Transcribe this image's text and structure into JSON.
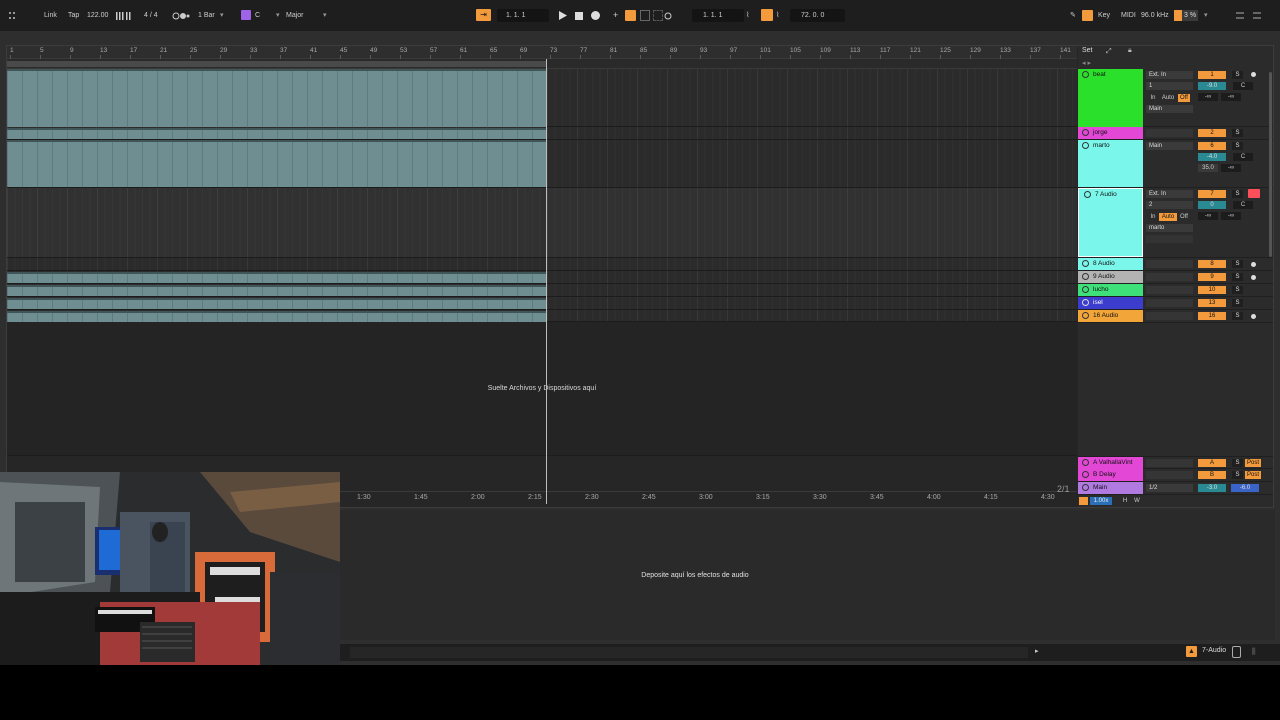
{
  "topbar": {
    "link": "Link",
    "tap": "Tap",
    "tempo": "122.00",
    "time_sig": "4 / 4",
    "quantize": "1 Bar",
    "key_root": "C",
    "scale": "Major",
    "arrangement_position": "1.   1.   1",
    "loop_start": "1.   1.   1",
    "loop_length": "72.   0.   0",
    "key_label": "Key",
    "midi_label": "MIDI",
    "sample_rate": "96.0 kHz",
    "cpu": "3 %"
  },
  "ruler": {
    "bars": [
      "1",
      "5",
      "9",
      "13",
      "17",
      "21",
      "25",
      "29",
      "33",
      "37",
      "41",
      "45",
      "49",
      "53",
      "57",
      "61",
      "65",
      "69",
      "73",
      "77",
      "81",
      "85",
      "89",
      "93",
      "97",
      "101",
      "105",
      "109",
      "113",
      "117",
      "121",
      "125",
      "129",
      "133",
      "137",
      "141"
    ],
    "set_label": "Set"
  },
  "time_ruler": {
    "marks": [
      "1:30",
      "1:45",
      "2:00",
      "2:15",
      "2:30",
      "2:45",
      "3:00",
      "3:15",
      "3:30",
      "3:45",
      "4:00",
      "4:15",
      "4:30"
    ]
  },
  "arrangement": {
    "empty_text": "Suelte Archivos y Dispositivos aquí",
    "page_count": "2/1"
  },
  "tracks": [
    {
      "name": "beat",
      "color": "#2be02b",
      "number": "1",
      "input": "Ext. In",
      "channel": "1",
      "monitor_in": "In",
      "monitor_auto": "Auto",
      "monitor_off": "Off",
      "output": "Main",
      "volume": "-9.0",
      "pan": "C",
      "send_a": "-∞",
      "send_b": "-∞"
    },
    {
      "name": "jorge",
      "color": "#e247d6",
      "number": "2"
    },
    {
      "name": "marto",
      "color": "#7af7ea",
      "number": "6",
      "output": "Main",
      "volume": "-4.0",
      "pan": "C",
      "send_a": "35.0",
      "send_b": "-∞"
    },
    {
      "name": "7 Audio",
      "color": "#7af7ea",
      "number": "7",
      "input": "Ext. In",
      "channel": "2",
      "monitor_in": "In",
      "monitor_auto": "Auto",
      "monitor_off": "Off",
      "output": "marto",
      "volume": "0",
      "pan": "C",
      "send_a": "-∞",
      "send_b": "-∞"
    },
    {
      "name": "8 Audio",
      "color": "#7af7ea",
      "number": "8"
    },
    {
      "name": "9 Audio",
      "color": "#b3b3b3",
      "number": "9"
    },
    {
      "name": "lucho",
      "color": "#3ee07a",
      "number": "10"
    },
    {
      "name": "isel",
      "color": "#3c3ccf",
      "number": "13"
    },
    {
      "name": "16 Audio",
      "color": "#f2a63a",
      "number": "16"
    }
  ],
  "returns": [
    {
      "name": "A ValhallaVint",
      "color": "#e247d6",
      "label": "A",
      "s": "S",
      "post": "Post"
    },
    {
      "name": "B Delay",
      "color": "#e247d6",
      "label": "B",
      "s": "S",
      "post": "Post"
    }
  ],
  "main": {
    "name": "Main",
    "color": "#b07ae0",
    "routing": "1/2",
    "volume": "-3.0",
    "pan": "-6.0",
    "zoom": "1.00x",
    "h": "H",
    "w": "W"
  },
  "mixer_buttons": {
    "solo": "S"
  },
  "device_area": {
    "empty_text": "Deposite aquí los efectos de audio"
  },
  "status": {
    "selected_track": "7-Audio"
  }
}
